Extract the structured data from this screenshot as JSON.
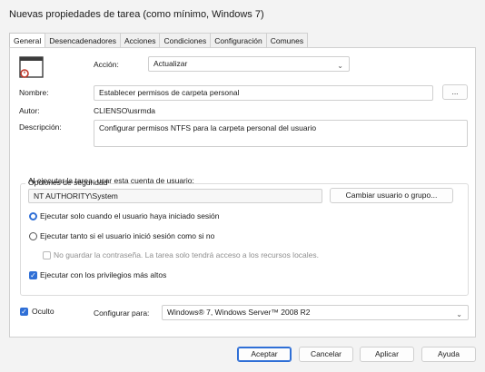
{
  "window": {
    "title": "Nuevas propiedades de tarea (como mínimo, Windows 7)"
  },
  "tabs": [
    {
      "label": "General"
    },
    {
      "label": "Desencadenadores"
    },
    {
      "label": "Acciones"
    },
    {
      "label": "Condiciones"
    },
    {
      "label": "Configuración"
    },
    {
      "label": "Comunes"
    }
  ],
  "general": {
    "accion_label": "Acción:",
    "accion_value": "Actualizar",
    "nombre_label": "Nombre:",
    "nombre_value": "Establecer permisos de carpeta personal",
    "browse_label": "...",
    "autor_label": "Autor:",
    "autor_value": "CLIENSO\\usrmda",
    "descripcion_label": "Descripción:",
    "descripcion_value": "Configurar permisos NTFS para la carpeta personal del usuario"
  },
  "security": {
    "group_title": "Opciones de seguridad",
    "run_as_label": "Al ejecutar la tarea, usar esta cuenta de usuario:",
    "run_as_value": "NT AUTHORITY\\System",
    "change_user_button": "Cambiar usuario o grupo...",
    "radio_logged_on": "Ejecutar solo cuando el usuario haya iniciado sesión",
    "radio_whether": "Ejecutar tanto si el usuario inició sesión como si no",
    "no_store_password": "No guardar la contraseña. La tarea solo tendrá acceso a los recursos locales.",
    "highest_privileges": "Ejecutar con los privilegios más altos"
  },
  "bottom": {
    "hidden_label": "Oculto",
    "configure_label": "Configurar para:",
    "configure_value": "Windows® 7, Windows Server™ 2008 R2"
  },
  "buttons": {
    "ok": "Aceptar",
    "cancel": "Cancelar",
    "apply": "Aplicar",
    "help": "Ayuda"
  },
  "colors": {
    "accent": "#2f6fd6",
    "panel": "#ffffff",
    "background": "#f3f3f3"
  }
}
